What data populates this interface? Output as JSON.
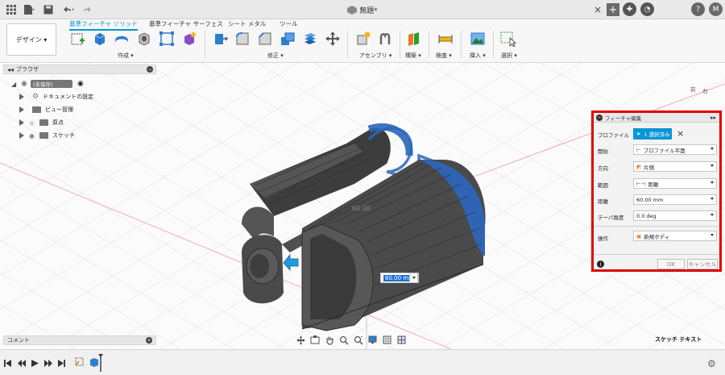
{
  "titlebar": {
    "document_title": "無題*",
    "icons": [
      "app-grid-icon",
      "file-icon",
      "save-icon",
      "undo-icon",
      "redo-icon",
      "close-tab-icon",
      "new-tab-icon",
      "extensions-icon",
      "job-status-icon",
      "help-icon",
      "account-icon"
    ],
    "account_initials": "M"
  },
  "toolbar": {
    "workspace_label": "デザイン ▾",
    "tabs": [
      "基準フィーチャ ソリッド",
      "基準フィーチャ サーフェス",
      "シート メタル",
      "ツール"
    ],
    "groups": [
      "作成 ▾",
      "修正 ▾",
      "アセンブリ ▾",
      "構築 ▾",
      "検査 ▾",
      "挿入 ▾",
      "選択 ▾"
    ]
  },
  "browser": {
    "title": "ブラウザ",
    "root": "(未保存)",
    "items": [
      "ドキュメントの設定",
      "ビュー管理",
      "原点",
      "スケッチ"
    ]
  },
  "comment": {
    "title": "コメント"
  },
  "viewport": {
    "dimension_ghost": "60.00",
    "distance_input": "60.00 mm",
    "viewcube_front": "前",
    "viewcube_right": "右",
    "sketch_text_label": "スケッチ テキスト"
  },
  "dialog": {
    "title": "フィーチャ編集",
    "profile_label": "プロファイル",
    "profile_value": "1 選択済み",
    "rows": [
      {
        "label": "開始",
        "value": "プロファイル平面"
      },
      {
        "label": "方向",
        "value": "片側"
      },
      {
        "label": "範囲",
        "value": "距離"
      },
      {
        "label": "距離",
        "value": "60.00 mm"
      },
      {
        "label": "テーパ角度",
        "value": "0.0 deg"
      },
      {
        "label": "操作",
        "value": "新規ボディ"
      }
    ],
    "ok_label": "OK",
    "cancel_label": "キャンセル"
  },
  "colors": {
    "accent": "#0696d7",
    "highlight_border": "#e00000",
    "body_dark": "#4a4a4a",
    "profile_blue": "#2a66b8"
  }
}
